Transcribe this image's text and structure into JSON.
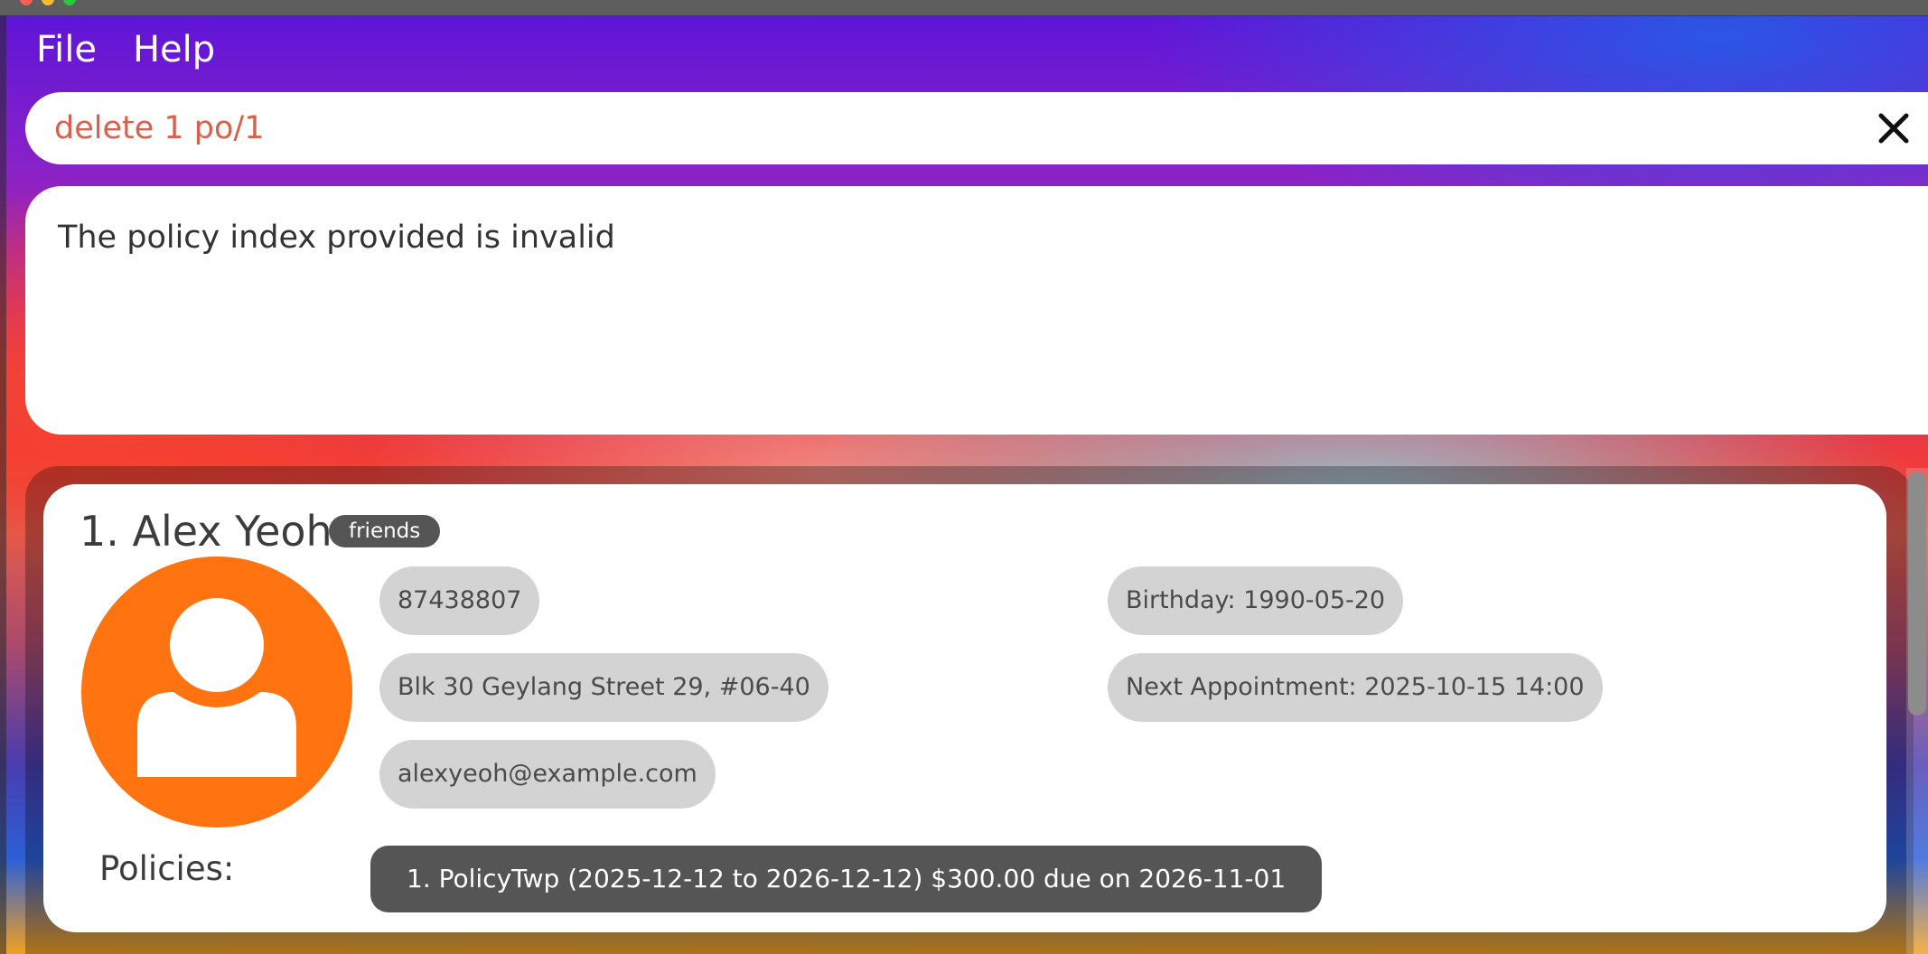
{
  "menu": {
    "file_label": "File",
    "help_label": "Help"
  },
  "command": {
    "value": "delete 1 po/1",
    "clear_icon": "close-icon"
  },
  "result": {
    "message": "The policy index provided is invalid"
  },
  "persons": [
    {
      "index_name": "1. Alex Yeoh",
      "tag": "friends",
      "phone": "87438807",
      "address": "Blk 30 Geylang Street 29, #06-40",
      "email": "alexyeoh@example.com",
      "birthday": "Birthday: 1990-05-20",
      "next_appointment": "Next Appointment: 2025-10-15 14:00",
      "policies_label": "Policies:",
      "policies": [
        "1. PolicyTwp (2025-12-12 to 2026-12-12) $300.00 due on 2026-11-01"
      ],
      "avatar_icon": "person-icon",
      "avatar_color": "#ff7410"
    }
  ],
  "colors": {
    "command_text": "#d9604a",
    "tag_bg": "#555555",
    "chip_bg": "#d3d3d3"
  }
}
